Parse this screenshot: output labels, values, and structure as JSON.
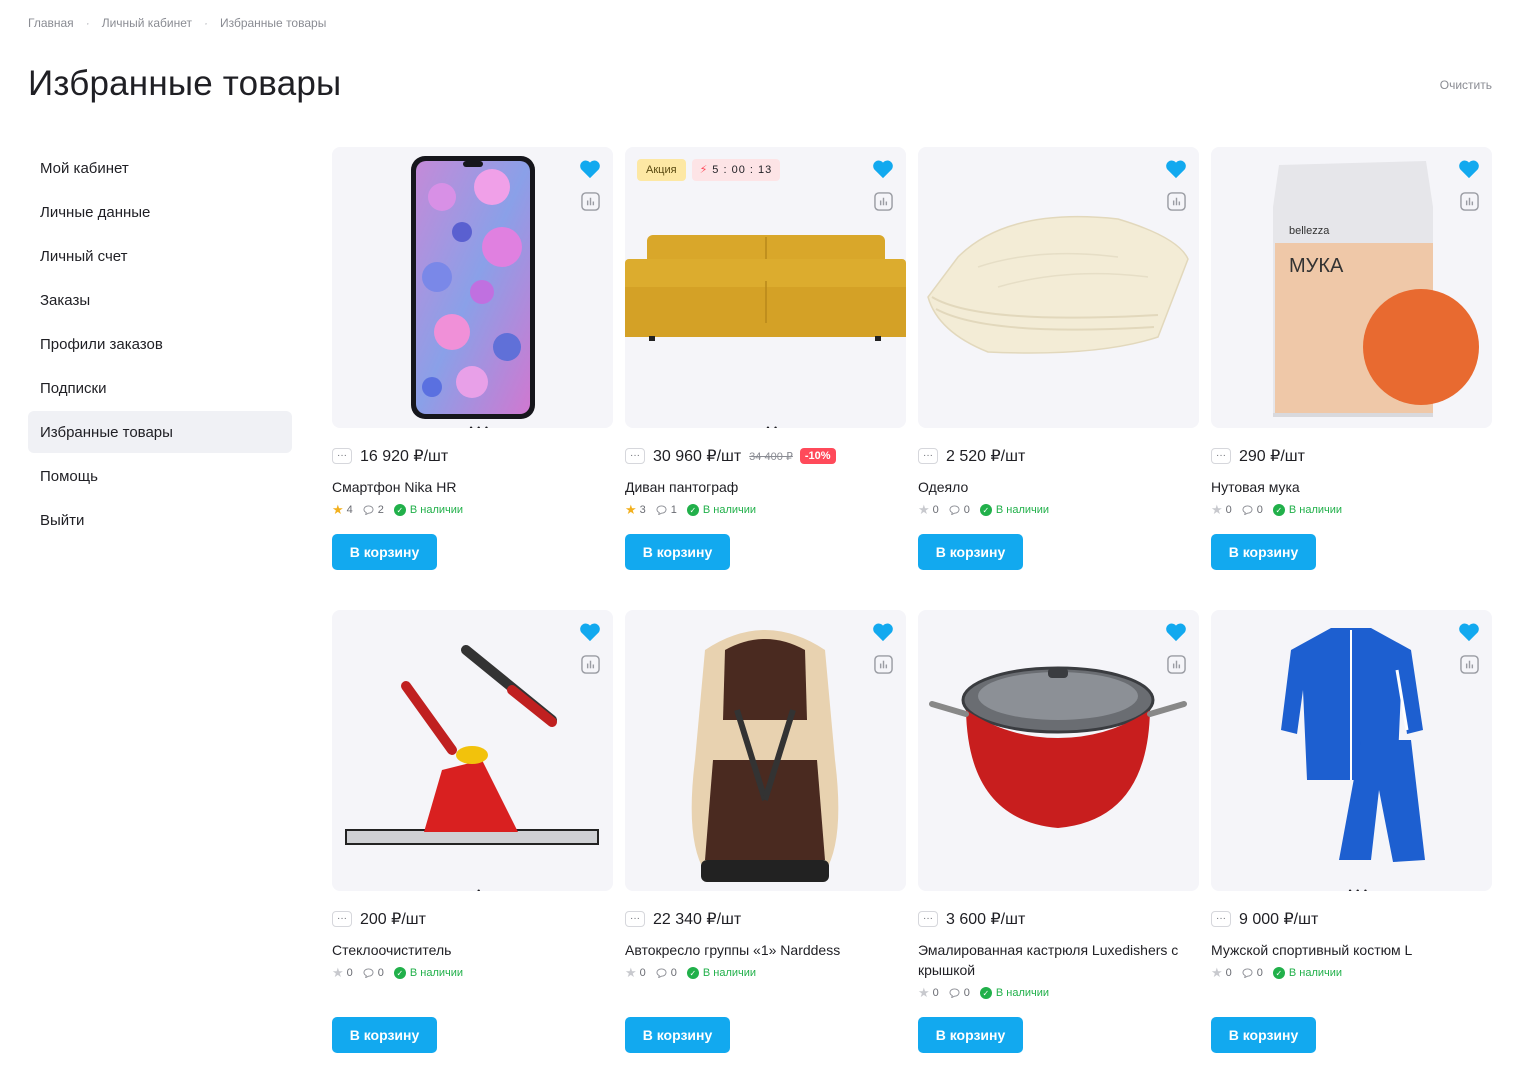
{
  "breadcrumb": [
    "Главная",
    "Личный кабинет",
    "Избранные товары"
  ],
  "page_title": "Избранные товары",
  "clear_label": "Очистить",
  "sidebar": {
    "items": [
      {
        "label": "Мой кабинет"
      },
      {
        "label": "Личные данные"
      },
      {
        "label": "Личный счет"
      },
      {
        "label": "Заказы"
      },
      {
        "label": "Профили заказов"
      },
      {
        "label": "Подписки"
      },
      {
        "label": "Избранные товары",
        "active": true
      },
      {
        "label": "Помощь"
      },
      {
        "label": "Выйти"
      }
    ]
  },
  "colors": {
    "accent": "#12a9ef",
    "in_stock": "#21b04a",
    "discount": "#ff4a5a",
    "sale_badge": "#fde8a4"
  },
  "icons": {
    "favorite": "heart-icon",
    "compare": "compare-chart-icon",
    "quantity": "more-dots-icon",
    "rating": "star-icon",
    "reviews": "comment-icon",
    "stock": "check-circle-icon"
  },
  "common": {
    "in_stock_label": "В наличии",
    "cart_label": "В корзину",
    "quantity_glyph": "···"
  },
  "products": [
    {
      "name": "Смартфон Nika HR",
      "price": "16 920 ₽/шт",
      "rating": "4",
      "reviews": "2",
      "rated": true,
      "dots": "▬ • • •"
    },
    {
      "name": "Диван пантограф",
      "price": "30 960 ₽/шт",
      "old_price": "34 400 ₽",
      "discount": "-10%",
      "rating": "3",
      "reviews": "1",
      "rated": true,
      "sale_label": "Акция",
      "timer": "5 : 00 : 13",
      "dots": "▬ • •"
    },
    {
      "name": "Одеяло",
      "price": "2 520 ₽/шт",
      "rating": "0",
      "reviews": "0",
      "rated": false,
      "dots": ""
    },
    {
      "name": "Нутовая мука",
      "price": "290 ₽/шт",
      "rating": "0",
      "reviews": "0",
      "rated": false,
      "dots": "",
      "pack_brand": "bellezza",
      "pack_title": "МУКА"
    },
    {
      "name": "Стеклоочиститель",
      "price": "200 ₽/шт",
      "rating": "0",
      "reviews": "0",
      "rated": false,
      "dots": "▬ •"
    },
    {
      "name": "Автокресло группы «1» Narddess",
      "price": "22 340 ₽/шт",
      "rating": "0",
      "reviews": "0",
      "rated": false,
      "dots": ""
    },
    {
      "name": "Эмалированная кастрюля Luxedishers с крышкой",
      "price": "3 600 ₽/шт",
      "rating": "0",
      "reviews": "0",
      "rated": false,
      "dots": ""
    },
    {
      "name": "Мужской спортивный костюм L",
      "price": "9 000 ₽/шт",
      "rating": "0",
      "reviews": "0",
      "rated": false,
      "dots": "▬ • • •"
    }
  ]
}
